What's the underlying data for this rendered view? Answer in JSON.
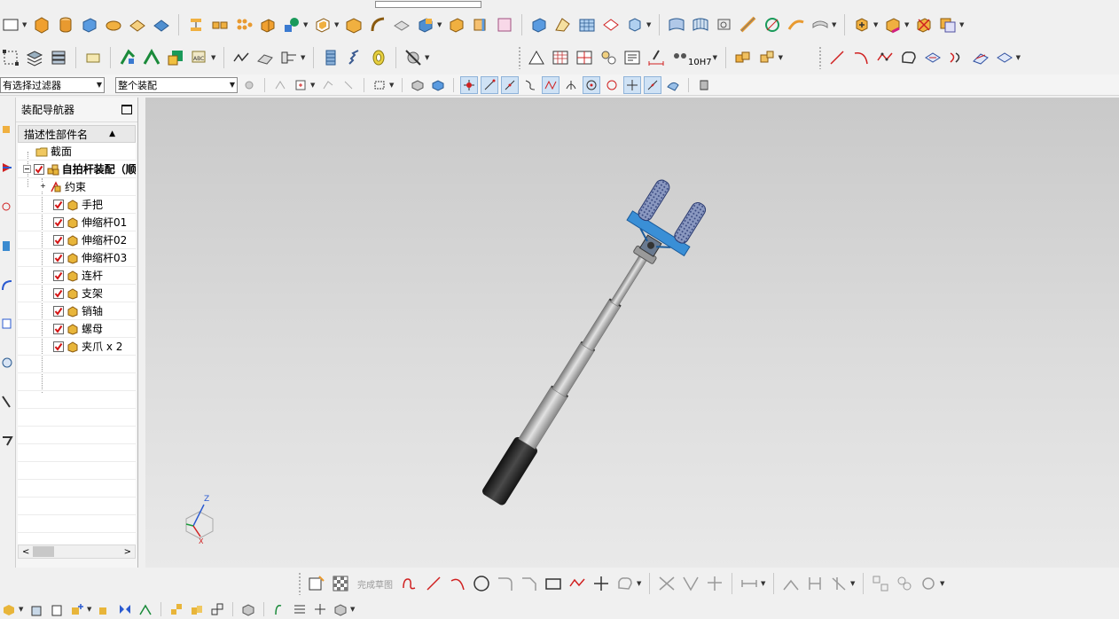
{
  "filters": {
    "selection_filter": "有选择过滤器",
    "scope": "整个装配",
    "view_label": "10H7"
  },
  "navigator": {
    "title": "装配导航器",
    "column_header": "描述性部件名",
    "items": [
      {
        "label": "截面"
      },
      {
        "label": "自拍杆装配（顺"
      },
      {
        "label": "约束"
      },
      {
        "label": "手把"
      },
      {
        "label": "伸缩杆01"
      },
      {
        "label": "伸缩杆02"
      },
      {
        "label": "伸缩杆03"
      },
      {
        "label": "连杆"
      },
      {
        "label": "支架"
      },
      {
        "label": "销轴"
      },
      {
        "label": "螺母"
      },
      {
        "label": "夹爪 x 2"
      }
    ]
  },
  "triad": {
    "z_label": "Z",
    "x_label": "X"
  },
  "sketch_toolbar": {
    "finish_label": "完成草图"
  },
  "colors": {
    "check_red": "#d41414",
    "part_yellow": "#e8b53a",
    "clamp_blue": "#3a8fd6",
    "grip_black": "#2a2a2a",
    "rod_grey": "#a9a9a9"
  }
}
